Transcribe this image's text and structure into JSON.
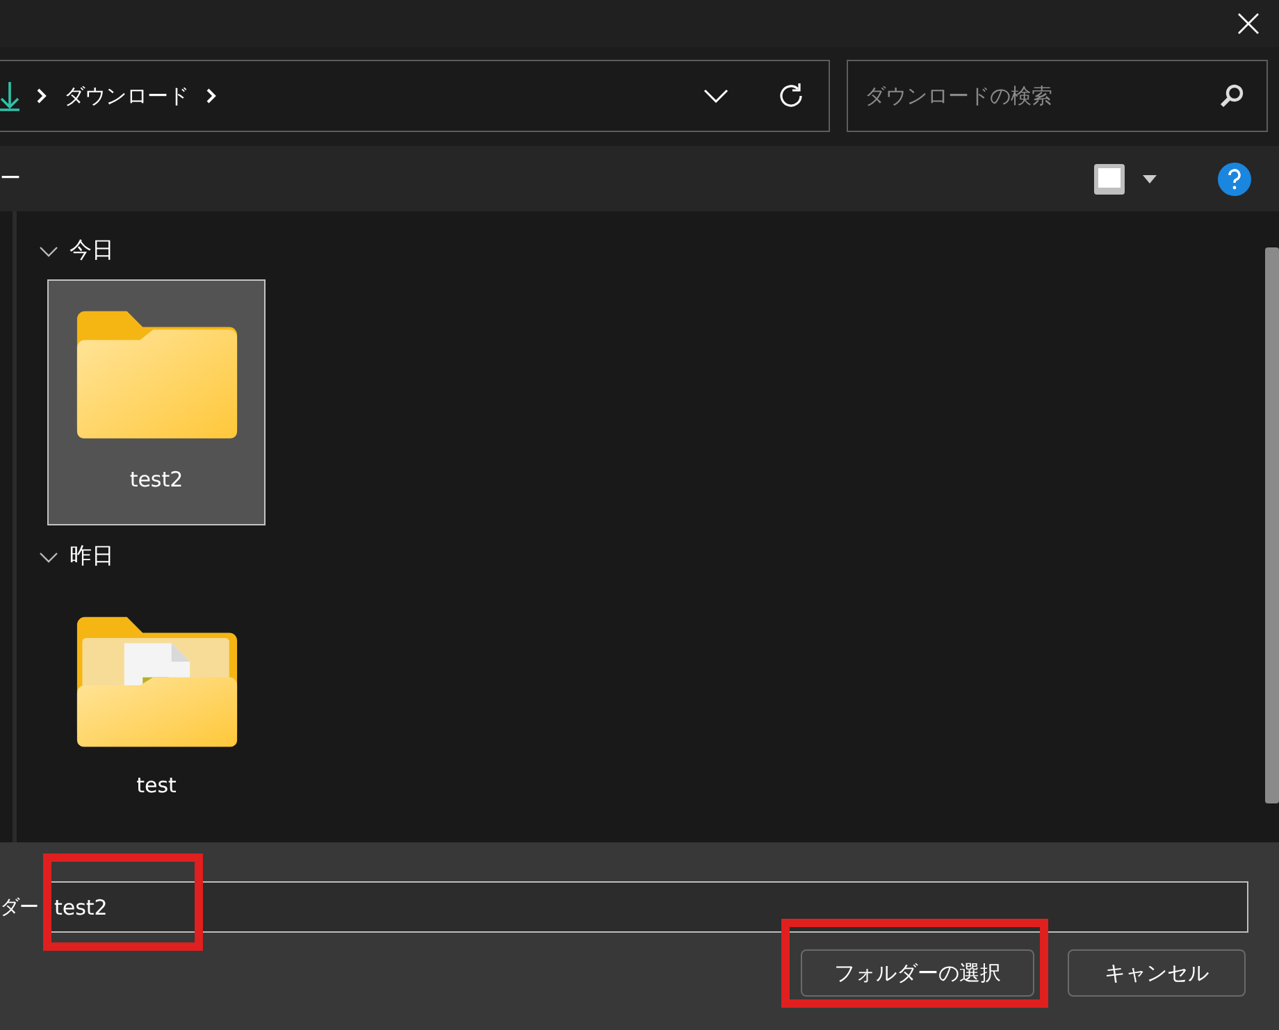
{
  "address": {
    "crumbs": [
      "ダウンロード"
    ]
  },
  "search": {
    "placeholder": "ダウンロードの検索"
  },
  "toolbar": {
    "label": "ー"
  },
  "groups": [
    {
      "title": "今日",
      "expanded": true,
      "items": [
        {
          "name": "test2",
          "selected": true,
          "kind": "folder"
        }
      ]
    },
    {
      "title": "昨日",
      "expanded": true,
      "items": [
        {
          "name": "test",
          "selected": false,
          "kind": "folder-with-file"
        }
      ]
    }
  ],
  "footer": {
    "label": "ダー",
    "field": {
      "value": "test2",
      "highlighted": true
    },
    "buttons": [
      {
        "label": "フォルダーの選択",
        "highlighted": true
      },
      {
        "label": "キャンセル",
        "highlighted": false
      }
    ]
  }
}
